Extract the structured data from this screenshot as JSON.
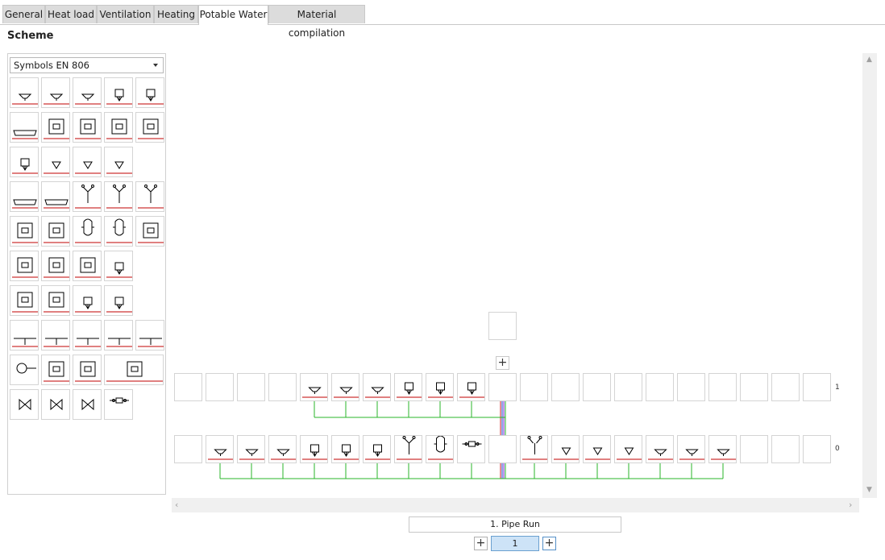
{
  "tabs": [
    {
      "label": "General"
    },
    {
      "label": "Heat load"
    },
    {
      "label": "Ventilation"
    },
    {
      "label": "Heating"
    },
    {
      "label": "Potable Water"
    },
    {
      "label": "Material compilation"
    }
  ],
  "active_tab": "Potable Water",
  "section_title": "Scheme",
  "palette": {
    "combo_value": "Symbols EN 806",
    "symbols": [
      "wash-basin",
      "small-basin",
      "bidet",
      "sink-wall",
      "sink-corner",
      "bathtub",
      "shower-cabinet",
      "shower-cabinet-2",
      "shower-tray",
      "round-tray",
      "wc-cistern",
      "urinal",
      "urinal-2",
      "wc-pan",
      "trough",
      "tray",
      "shower-head",
      "hose-valve",
      "spray-nozzle",
      "heater-unit",
      "heater-unit-2",
      "storage-tank",
      "boiler",
      "heat-exchanger",
      "meter-box",
      "wall-unit",
      "unit-small",
      "valve-small",
      "pump-group",
      "pump-group-2",
      "dishwasher",
      "connection",
      "tee-left",
      "tee-center",
      "tee-right",
      "tee-up",
      "tee-down",
      "circulation-pump",
      "water-heater",
      "tank-multi",
      "distribution",
      "gate-valve",
      "stop-valve",
      "valve-group",
      "inline-filter"
    ]
  },
  "scheme": {
    "floor_labels": [
      "1",
      "0"
    ],
    "pipe_run_label": "1. Pipe Run",
    "page_number": "1",
    "colors": {
      "pipe": "#2ab52a",
      "riser_red": "#d02020",
      "riser_blue": "#2050d0",
      "riser_purple": "#8a2be2",
      "symbol_line": "#c00000"
    }
  }
}
